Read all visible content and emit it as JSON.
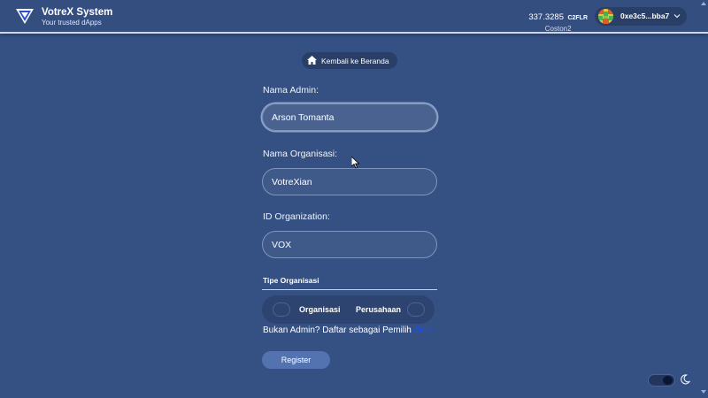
{
  "header": {
    "brand_title": "VotreX System",
    "brand_subtitle": "Your trusted dApps",
    "balance_amount": "337.3285",
    "balance_unit": "C2FLR",
    "network": "Coston2",
    "account_address": "0xe3c5...bba7"
  },
  "back_button": {
    "label": "Kembali ke Beranda",
    "icon": "home-icon"
  },
  "form": {
    "admin_name": {
      "label": "Nama Admin:",
      "value": "Arson Tomanta"
    },
    "org_name": {
      "label": "Nama Organisasi:",
      "value": "VotreXian"
    },
    "org_id": {
      "label": "ID Organization:",
      "value": "VOX"
    },
    "org_type": {
      "label": "Tipe Organisasi",
      "options": [
        "Organisasi",
        "Perusahaan"
      ]
    },
    "not_admin": {
      "text": "Bukan Admin? Daftar sebagai Pemilih ",
      "link": "disini"
    },
    "register_label": "Register"
  },
  "colors": {
    "background": "#355183",
    "accent": "#5273b0",
    "link": "#1f4df0"
  }
}
